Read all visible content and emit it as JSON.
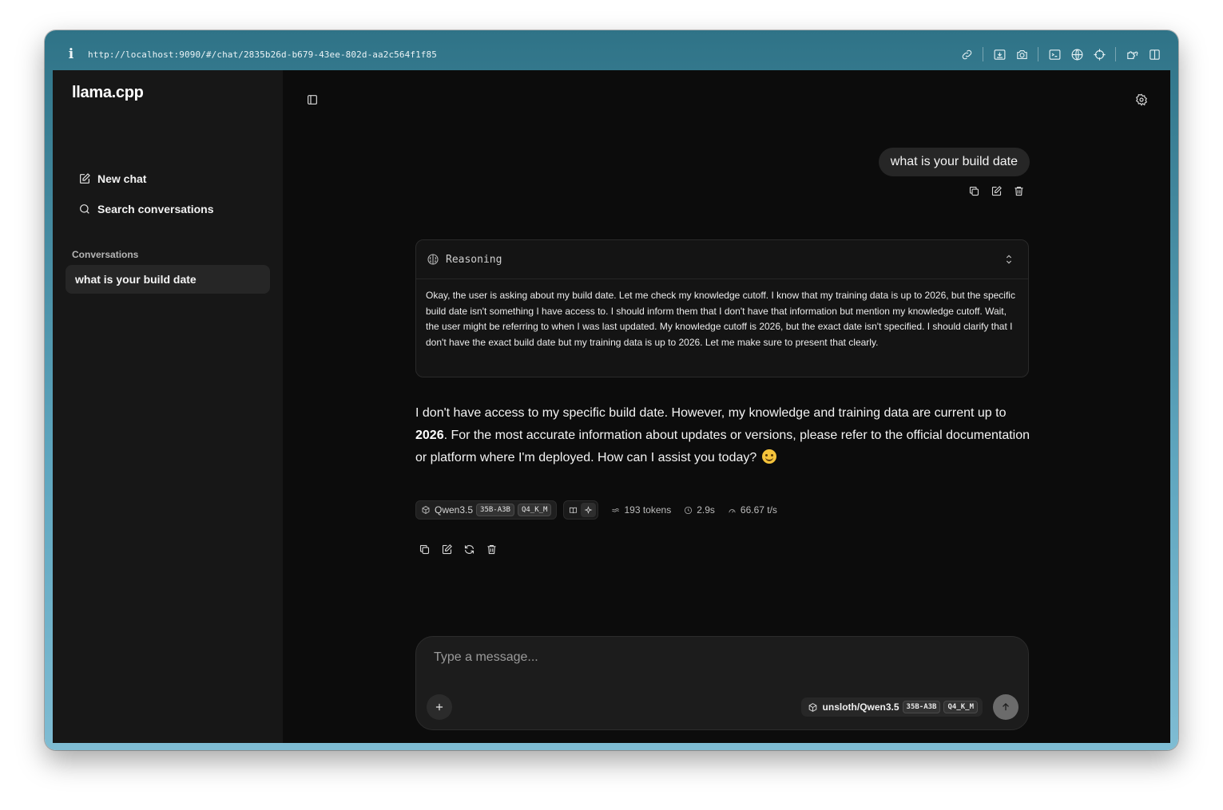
{
  "browser": {
    "url": "http://localhost:9090/#/chat/2835b26d-b679-43ee-802d-aa2c564f1f85",
    "info_glyph": "i"
  },
  "sidebar": {
    "brand": "llama.cpp",
    "new_chat_label": "New chat",
    "search_label": "Search conversations",
    "section_label": "Conversations",
    "conversations": [
      {
        "title": "what is your build date"
      }
    ]
  },
  "chat": {
    "user_message": "what is your build date",
    "reasoning": {
      "title": "Reasoning",
      "text": "Okay, the user is asking about my build date. Let me check my knowledge cutoff. I know that my training data is up to 2026, but the specific build date isn't something I have access to. I should inform them that I don't have that information but mention my knowledge cutoff. Wait, the user might be referring to when I was last updated. My knowledge cutoff is 2026, but the exact date isn't specified. I should clarify that I don't have the exact build date but my training data is up to 2026. Let me make sure to present that clearly."
    },
    "answer": {
      "part1": "I don't have access to my specific build date. However, my knowledge and training data are current up to ",
      "bold": "2026",
      "part2": ". For the most accurate information about updates or versions, please refer to the official documentation or platform where I'm deployed. How can I assist you today?"
    },
    "meta": {
      "model_name": "Qwen3.5",
      "model_tag_size": "35B-A3B",
      "model_tag_quant": "Q4_K_M",
      "tokens": "193 tokens",
      "time": "2.9s",
      "speed": "66.67 t/s"
    }
  },
  "composer": {
    "placeholder": "Type a message...",
    "model_name": "unsloth/Qwen3.5",
    "model_tag_size": "35B-A3B",
    "model_tag_quant": "Q4_K_M"
  },
  "colors": {
    "background": "#0c0c0c",
    "sidebar": "#171717",
    "bubble": "#262626",
    "window_frame": "#2f7387"
  }
}
